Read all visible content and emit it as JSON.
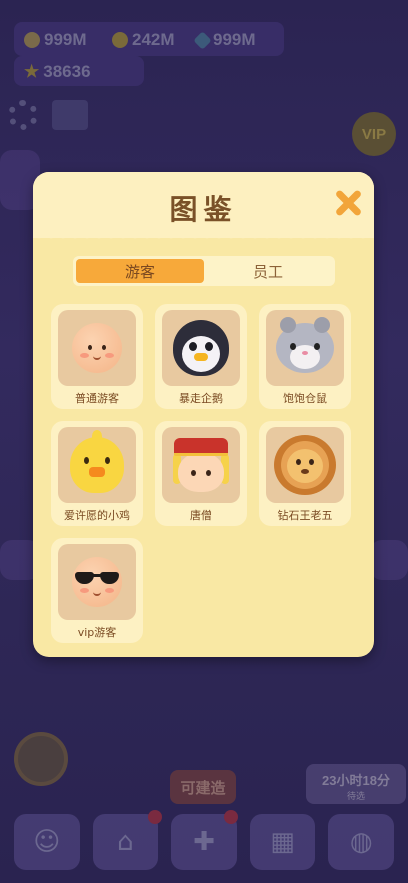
{
  "hud": {
    "coins_a": "999M",
    "coins_b": "242M",
    "gems": "999M",
    "stars": "38636"
  },
  "background": {
    "timer": "23小时18分",
    "timer_sub": "待选",
    "build_tip": "可建造",
    "vip_badge": "VIP"
  },
  "modal": {
    "title": "图鉴",
    "tabs": [
      {
        "label": "游客",
        "active": true
      },
      {
        "label": "员工",
        "active": false
      }
    ],
    "characters": [
      {
        "name": "普通游客",
        "icon": "plain-guest-icon"
      },
      {
        "name": "暴走企鹅",
        "icon": "penguin-icon"
      },
      {
        "name": "饱饱仓鼠",
        "icon": "hamster-icon"
      },
      {
        "name": "爱许愿的小鸡",
        "icon": "chick-icon"
      },
      {
        "name": "唐僧",
        "icon": "monk-icon"
      },
      {
        "name": "钻石王老五",
        "icon": "lion-icon"
      },
      {
        "name": "vip游客",
        "icon": "vip-guest-icon"
      }
    ]
  },
  "colors": {
    "panel": "#f9e8a4",
    "tab_active": "#f7a93a",
    "title": "#7a5128",
    "close": "#f2a53a"
  }
}
